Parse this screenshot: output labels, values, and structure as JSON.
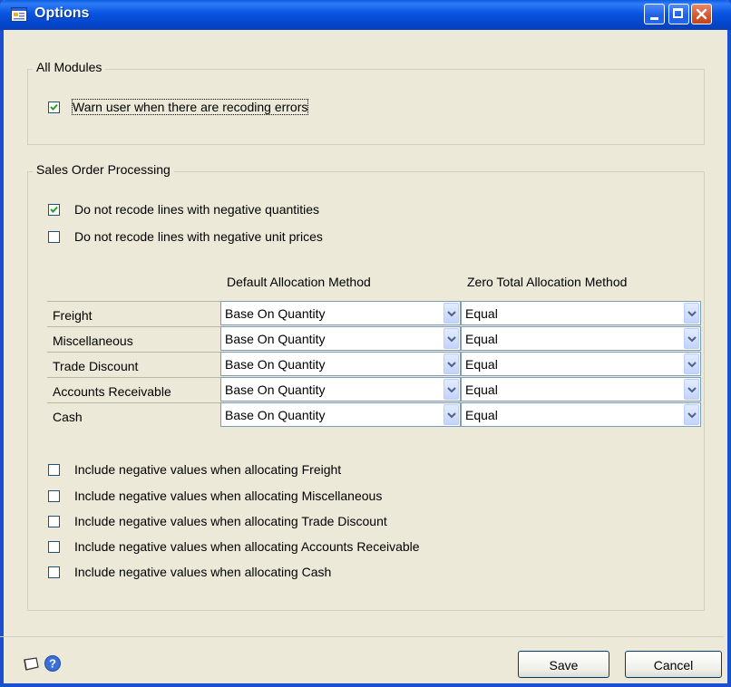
{
  "window": {
    "title": "Options"
  },
  "all_modules": {
    "label": "All Modules",
    "warn_recoding": {
      "label": "Warn user when there are recoding errors",
      "checked": true
    }
  },
  "sop": {
    "label": "Sales Order Processing",
    "no_recode_neg_qty": {
      "label": "Do not recode lines with negative quantities",
      "checked": true
    },
    "no_recode_neg_price": {
      "label": "Do not recode lines with negative unit prices",
      "checked": false
    },
    "col_default": "Default Allocation Method",
    "col_zero": "Zero Total Allocation Method",
    "rows": [
      {
        "label": "Freight",
        "default": "Base On Quantity",
        "zero": "Equal"
      },
      {
        "label": "Miscellaneous",
        "default": "Base On Quantity",
        "zero": "Equal"
      },
      {
        "label": "Trade Discount",
        "default": "Base On Quantity",
        "zero": "Equal"
      },
      {
        "label": "Accounts Receivable",
        "default": "Base On Quantity",
        "zero": "Equal"
      },
      {
        "label": "Cash",
        "default": "Base On Quantity",
        "zero": "Equal"
      }
    ],
    "include": [
      {
        "label": "Include negative values when allocating Freight",
        "checked": false
      },
      {
        "label": "Include negative values when allocating Miscellaneous",
        "checked": false
      },
      {
        "label": "Include negative values when allocating Trade Discount",
        "checked": false
      },
      {
        "label": "Include negative values when allocating Accounts Receivable",
        "checked": false
      },
      {
        "label": "Include negative values when allocating Cash",
        "checked": false
      }
    ]
  },
  "buttons": {
    "save": "Save",
    "cancel": "Cancel"
  },
  "icons": {
    "note": "note-icon",
    "help": "help-icon"
  },
  "colors": {
    "titlebar": "#0854e0",
    "check": "#21a121",
    "background": "#ece9d8"
  }
}
